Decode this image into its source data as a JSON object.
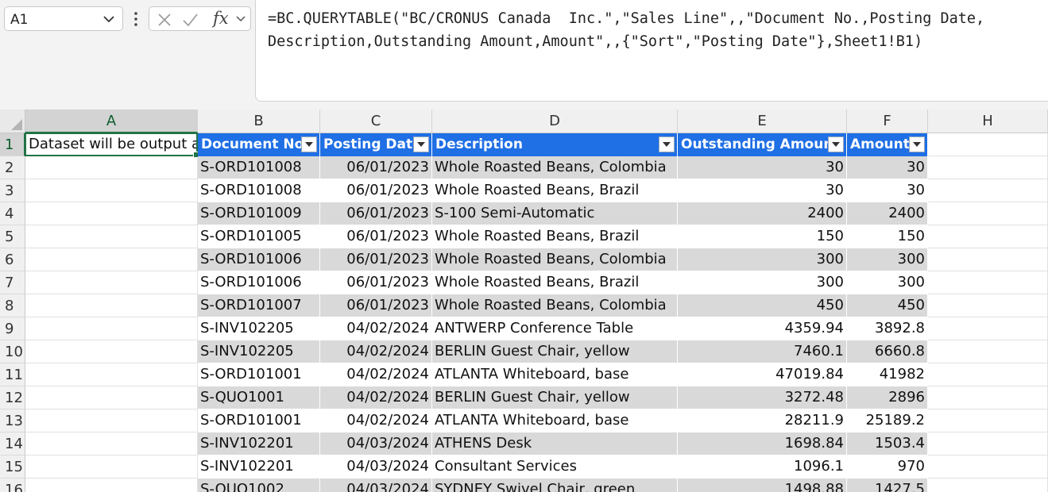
{
  "name_box": {
    "value": "A1"
  },
  "formula_bar": {
    "fx_label": "fx",
    "formula": "=BC.QUERYTABLE(\"BC/CRONUS Canada  Inc.\",\"Sales Line\",,\"Document No.,Posting Date, Description,Outstanding Amount,Amount\",,{\"Sort\",\"Posting Date\"},Sheet1!B1)"
  },
  "columns": [
    "A",
    "B",
    "C",
    "D",
    "E",
    "F",
    "H"
  ],
  "row_numbers": [
    "1",
    "2",
    "3",
    "4",
    "5",
    "6",
    "7",
    "8",
    "9",
    "10",
    "11",
    "12",
    "13",
    "14",
    "15",
    "16"
  ],
  "cell_a1": "Dataset will be output as",
  "table": {
    "headers": [
      "Document No.",
      "Posting Date",
      "Description",
      "Outstanding Amount",
      "Amount"
    ],
    "rows": [
      [
        "S-ORD101008",
        "06/01/2023",
        "Whole Roasted Beans, Colombia",
        "30",
        "30"
      ],
      [
        "S-ORD101008",
        "06/01/2023",
        "Whole Roasted Beans, Brazil",
        "30",
        "30"
      ],
      [
        "S-ORD101009",
        "06/01/2023",
        "S-100 Semi-Automatic",
        "2400",
        "2400"
      ],
      [
        "S-ORD101005",
        "06/01/2023",
        "Whole Roasted Beans, Brazil",
        "150",
        "150"
      ],
      [
        "S-ORD101006",
        "06/01/2023",
        "Whole Roasted Beans, Colombia",
        "300",
        "300"
      ],
      [
        "S-ORD101006",
        "06/01/2023",
        "Whole Roasted Beans, Brazil",
        "300",
        "300"
      ],
      [
        "S-ORD101007",
        "06/01/2023",
        "Whole Roasted Beans, Colombia",
        "450",
        "450"
      ],
      [
        "S-INV102205",
        "04/02/2024",
        "ANTWERP Conference Table",
        "4359.94",
        "3892.8"
      ],
      [
        "S-INV102205",
        "04/02/2024",
        "BERLIN Guest Chair, yellow",
        "7460.1",
        "6660.8"
      ],
      [
        "S-ORD101001",
        "04/02/2024",
        "ATLANTA Whiteboard, base",
        "47019.84",
        "41982"
      ],
      [
        "S-QUO1001",
        "04/02/2024",
        "BERLIN Guest Chair, yellow",
        "3272.48",
        "2896"
      ],
      [
        "S-ORD101001",
        "04/02/2024",
        "ATLANTA Whiteboard, base",
        "28211.9",
        "25189.2"
      ],
      [
        "S-INV102201",
        "04/03/2024",
        "ATHENS Desk",
        "1698.84",
        "1503.4"
      ],
      [
        "S-INV102201",
        "04/03/2024",
        "Consultant Services",
        "1096.1",
        "970"
      ],
      [
        "S-QUO1002",
        "04/03/2024",
        "SYDNEY Swivel Chair, green",
        "1498.88",
        "1427.5"
      ]
    ]
  },
  "colors": {
    "table_header": "#1f6fe5",
    "band": "#d9d9d9",
    "selection": "#217346"
  }
}
